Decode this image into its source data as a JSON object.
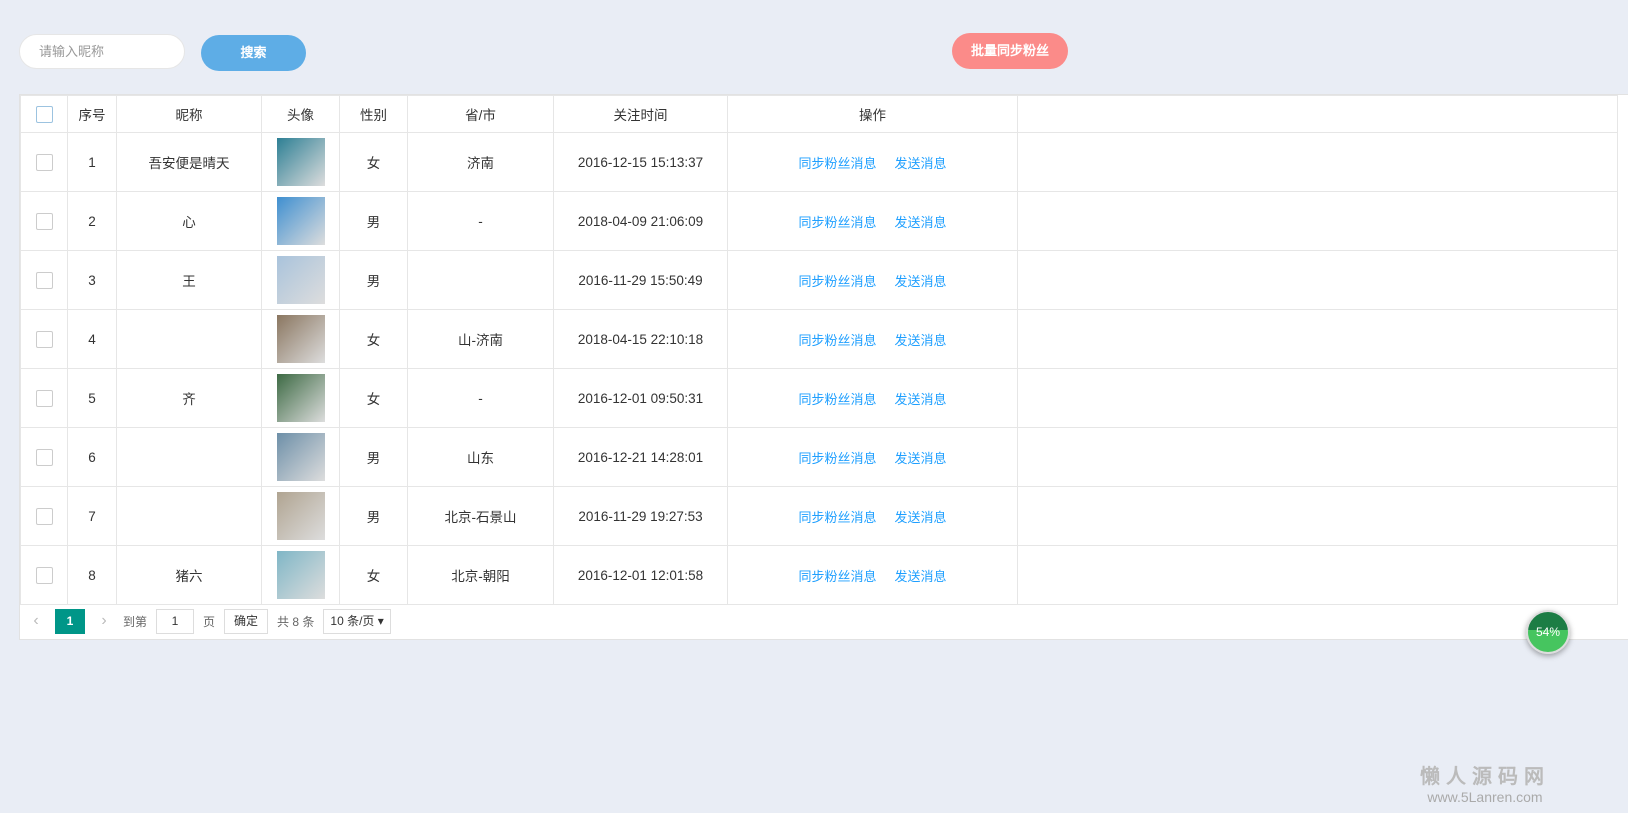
{
  "toolbar": {
    "search_placeholder": "请输入昵称",
    "search_label": "搜索",
    "sync_label": "批量同步粉丝"
  },
  "columns": [
    "序号",
    "昵称",
    "头像",
    "性别",
    "省/市",
    "关注时间",
    "操作"
  ],
  "rows": [
    {
      "no": "1",
      "nick": "吾安便是晴天",
      "avatar": "#2d7f94",
      "gender": "女",
      "region": "济南",
      "time": "2016-12-15 15:13:37"
    },
    {
      "no": "2",
      "nick": "心",
      "avatar": "#3f8fd0",
      "gender": "男",
      "region": "-",
      "time": "2018-04-09 21:06:09"
    },
    {
      "no": "3",
      "nick": "王",
      "avatar": "#a9c3dc",
      "gender": "男",
      "region": "",
      "time": "2016-11-29 15:50:49"
    },
    {
      "no": "4",
      "nick": "",
      "avatar": "#8a7660",
      "gender": "女",
      "region": "山-济南",
      "time": "2018-04-15 22:10:18"
    },
    {
      "no": "5",
      "nick": "齐",
      "avatar": "#3d6a44",
      "gender": "女",
      "region": "-",
      "time": "2016-12-01 09:50:31"
    },
    {
      "no": "6",
      "nick": "",
      "avatar": "#6d8fa8",
      "gender": "男",
      "region": "山东",
      "time": "2016-12-21 14:28:01"
    },
    {
      "no": "7",
      "nick": "",
      "avatar": "#b0a491",
      "gender": "男",
      "region": "北京-石景山",
      "time": "2016-11-29 19:27:53"
    },
    {
      "no": "8",
      "nick": "猪六",
      "avatar": "#7fb6c6",
      "gender": "女",
      "region": "北京-朝阳",
      "time": "2016-12-01 12:01:58"
    }
  ],
  "actions": {
    "sync": "同步粉丝消息",
    "send": "发送消息"
  },
  "pager": {
    "prev": "‹",
    "current": "1",
    "next": "›",
    "goto": "到第",
    "page_value": "1",
    "page": "页",
    "confirm": "确定",
    "total": "共 8 条",
    "per_page": "10 条/页 ▾"
  },
  "gauge": "54%",
  "watermark": {
    "name": "懒人源码网",
    "url": "www.5Lanren.com"
  }
}
